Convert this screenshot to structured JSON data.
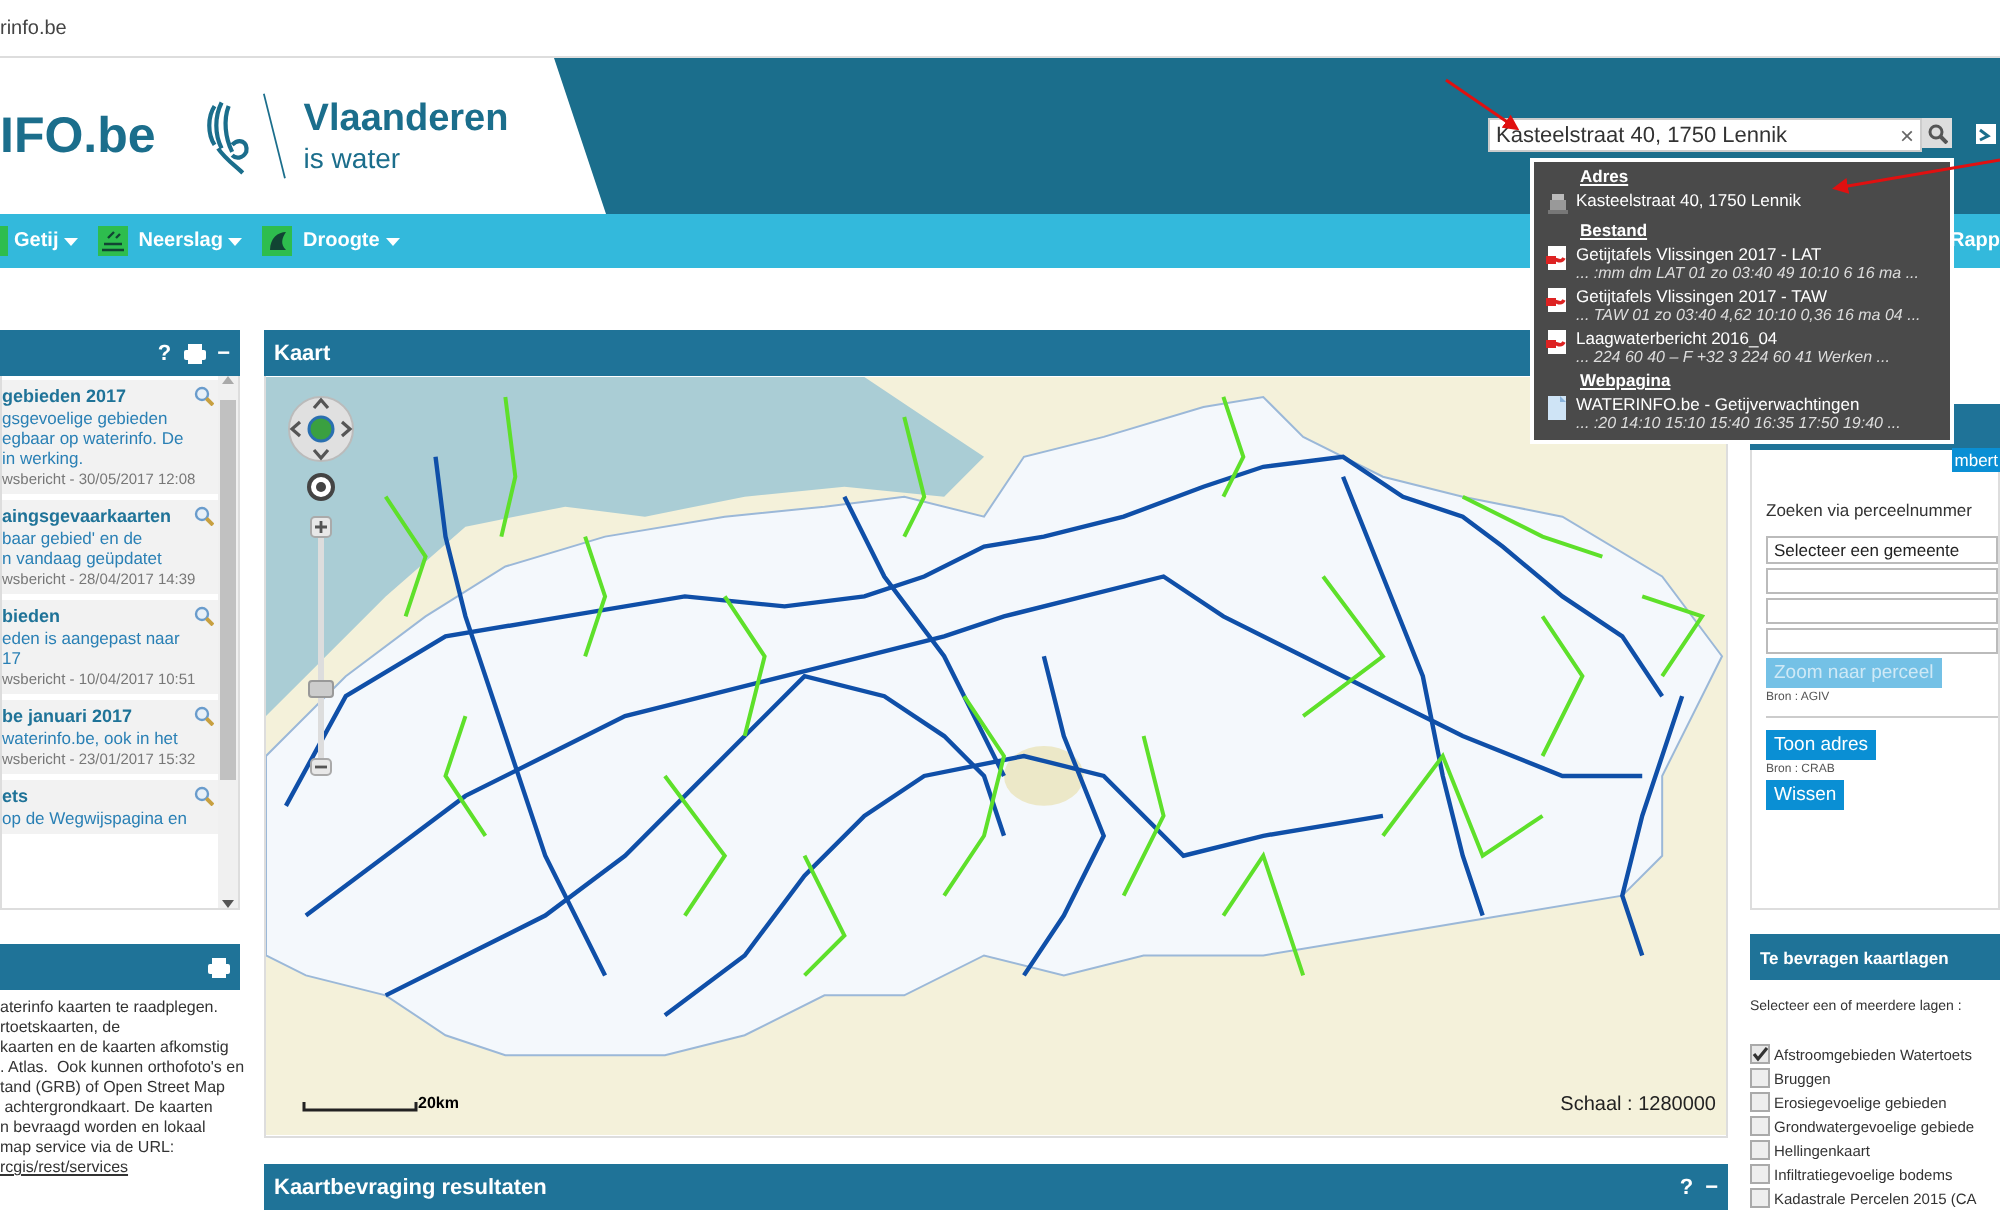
{
  "browser": {
    "url": "rinfo.be"
  },
  "header": {
    "logo": "IFO.be",
    "brand": "Vlaanderen",
    "tagline": "is water",
    "search": {
      "value": "Kasteelstraat 40, 1750 Lennik",
      "clear": "×"
    }
  },
  "nav": {
    "items": [
      {
        "label": "Getij"
      },
      {
        "label": "Neerslag"
      },
      {
        "label": "Droogte"
      }
    ],
    "right_item": "Rapp"
  },
  "search_results": {
    "groups": [
      {
        "kind": "address",
        "heading": "Adres",
        "items": [
          {
            "title": "Kasteelstraat 40, 1750 Lennik"
          }
        ]
      },
      {
        "kind": "file",
        "heading": "Bestand",
        "items": [
          {
            "title": "Getijtafels Vlissingen 2017 - LAT",
            "snippet": "... :mm dm LAT 01 zo 03:40 49 10:10 6 16 ma ..."
          },
          {
            "title": "Getijtafels Vlissingen 2017 - TAW",
            "snippet": "... TAW 01 zo 03:40 4,62 10:10 0,36 16 ma 04 ..."
          },
          {
            "title": "Laagwaterbericht 2016_04",
            "snippet": "... 224 60 40 – F +32 3 224 60 41 Werken ..."
          }
        ]
      },
      {
        "kind": "webpage",
        "heading": "Webpagina",
        "items": [
          {
            "title": "WATERINFO.be - Getijverwachtingen",
            "snippet": "... :20 14:10 15:10 15:40 16:35 17:50 19:40 ..."
          }
        ]
      }
    ]
  },
  "news_panel": {
    "help": "?",
    "collapse": "−",
    "items": [
      {
        "title": "gebieden 2017",
        "body": "gsgevoelige gebieden\negbaar op waterinfo. De\nin werking.",
        "meta": "wsbericht - 30/05/2017 12:08"
      },
      {
        "title": "aingsgevaarkaarten",
        "body": "baar gebied' en de\nn vandaag geüpdatet",
        "meta": "wsbericht - 28/04/2017 14:39"
      },
      {
        "title": "bieden",
        "body": "eden is aangepast naar\n17",
        "meta": "wsbericht - 10/04/2017 10:51"
      },
      {
        "title": "be januari 2017",
        "body": "waterinfo.be, ook in het",
        "meta": "wsbericht - 23/01/2017 15:32"
      },
      {
        "title": "ets",
        "body": "op de Wegwijspagina en"
      }
    ]
  },
  "info_panel": {
    "text": "aterinfo kaarten te raadplegen.\nrtoetskaarten, de\nkaarten en de kaarten afkomstig\n. Atlas.  Ook kunnen orthofoto's en\ntand (GRB) of Open Street Map\n achtergrondkaart. De kaarten\nn bevraagd worden en lokaal\nmap service via de URL:",
    "link": "rcgis/rest/services"
  },
  "map_panel": {
    "title": "Kaart",
    "zoom_slider": {
      "level": 0.3
    },
    "scale_bar": "20km",
    "scale": "Schaal : 1280000"
  },
  "results_panel": {
    "title": "Kaartbevraging resultaten",
    "help": "?",
    "collapse": "−"
  },
  "parcel_panel": {
    "tab": "mbert",
    "label": "Zoeken via perceelnummer",
    "municipality_select": "Selecteer een gemeente",
    "zoom_button": {
      "label": "Zoom naar perceel",
      "disabled": true
    },
    "source_1": "Bron : AGIV",
    "address_button": "Toon adres",
    "source_2": "Bron : CRAB",
    "clear_button": "Wissen"
  },
  "layers_panel": {
    "title": "Te bevragen kaartlagen",
    "instruction": "Selecteer een of meerdere lagen :",
    "layers": [
      {
        "label": "Afstroomgebieden Watertoets",
        "checked": true
      },
      {
        "label": "Bruggen",
        "checked": false
      },
      {
        "label": "Erosiegevoelige gebieden",
        "checked": false
      },
      {
        "label": "Grondwatergevoelige gebiede",
        "checked": false
      },
      {
        "label": "Hellingenkaart",
        "checked": false
      },
      {
        "label": "Infiltratiegevoelige bodems",
        "checked": false
      },
      {
        "label": "Kadastrale Percelen 2015 (CA",
        "checked": false
      }
    ]
  }
}
